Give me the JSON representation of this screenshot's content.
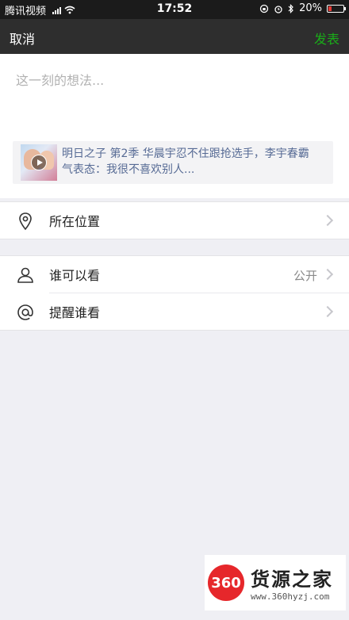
{
  "status_bar": {
    "carrier": "腾讯视频",
    "time": "17:52",
    "battery": "20%",
    "battery_level": 0.2,
    "battery_color": "#e53935"
  },
  "nav": {
    "cancel_label": "取消",
    "publish_label": "发表",
    "publish_color": "#1aad19"
  },
  "compose": {
    "placeholder": "这一刻的想法...",
    "share_card": {
      "title": "明日之子 第2季 华晨宇忍不住跟抢选手，李宇春霸气表态：我很不喜欢别人...",
      "thumbnail_icon": "video-play-icon"
    }
  },
  "options": {
    "location": {
      "label": "所在位置",
      "icon": "location-pin-icon"
    },
    "visibility": {
      "label": "谁可以看",
      "value": "公开",
      "icon": "person-icon"
    },
    "mention": {
      "label": "提醒谁看",
      "icon": "at-sign-icon"
    }
  },
  "watermark": {
    "logo_text": "360",
    "brand": "货源之家",
    "url": "www.360hyzj.com"
  }
}
